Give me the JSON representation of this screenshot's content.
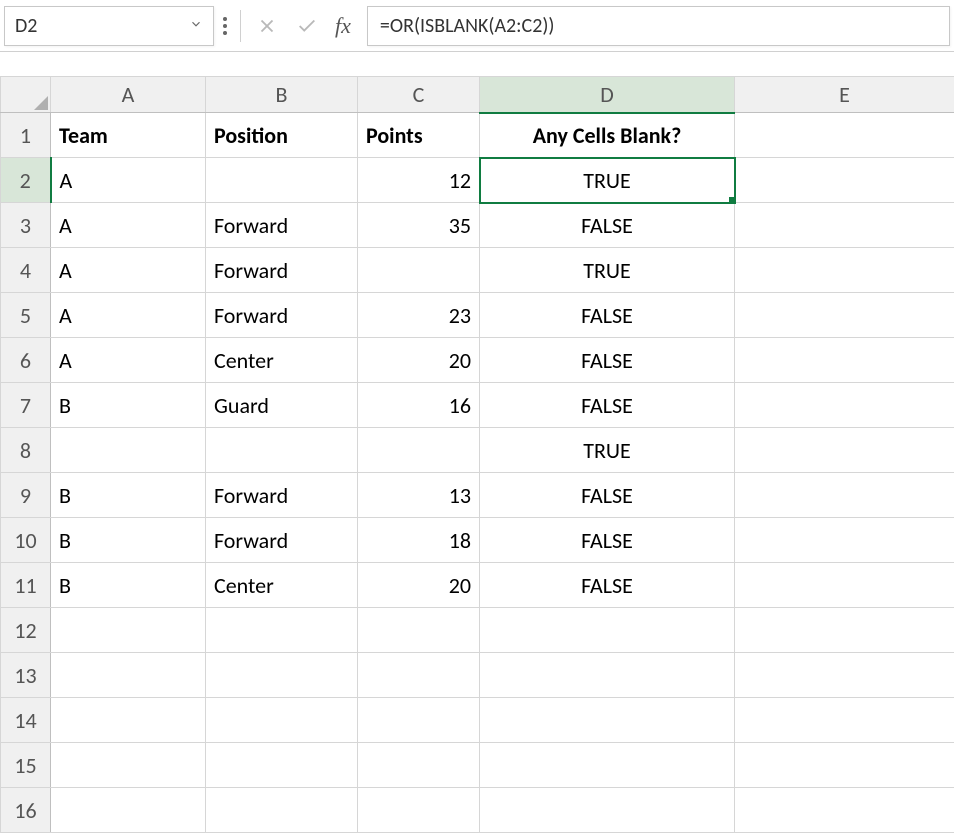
{
  "nameBox": "D2",
  "formula": "=OR(ISBLANK(A2:C2))",
  "fxLabel": "fx",
  "colHeaders": [
    "A",
    "B",
    "C",
    "D",
    "E"
  ],
  "rowHeaders": [
    "1",
    "2",
    "3",
    "4",
    "5",
    "6",
    "7",
    "8",
    "9",
    "10",
    "11",
    "12",
    "13",
    "14",
    "15",
    "16"
  ],
  "headerRow": {
    "team": "Team",
    "position": "Position",
    "points": "Points",
    "anyBlank": "Any Cells Blank?"
  },
  "rows": [
    {
      "team": "A",
      "position": "",
      "points": "12",
      "anyBlank": "TRUE"
    },
    {
      "team": "A",
      "position": "Forward",
      "points": "35",
      "anyBlank": "FALSE"
    },
    {
      "team": "A",
      "position": "Forward",
      "points": "",
      "anyBlank": "TRUE"
    },
    {
      "team": "A",
      "position": "Forward",
      "points": "23",
      "anyBlank": "FALSE"
    },
    {
      "team": "A",
      "position": "Center",
      "points": "20",
      "anyBlank": "FALSE"
    },
    {
      "team": "B",
      "position": "Guard",
      "points": "16",
      "anyBlank": "FALSE"
    },
    {
      "team": "",
      "position": "",
      "points": "",
      "anyBlank": "TRUE"
    },
    {
      "team": "B",
      "position": "Forward",
      "points": "13",
      "anyBlank": "FALSE"
    },
    {
      "team": "B",
      "position": "Forward",
      "points": "18",
      "anyBlank": "FALSE"
    },
    {
      "team": "B",
      "position": "Center",
      "points": "20",
      "anyBlank": "FALSE"
    }
  ],
  "chart_data": {
    "type": "table",
    "title": "",
    "columns": [
      "Team",
      "Position",
      "Points",
      "Any Cells Blank?"
    ],
    "data": [
      [
        "A",
        "",
        12,
        "TRUE"
      ],
      [
        "A",
        "Forward",
        35,
        "FALSE"
      ],
      [
        "A",
        "Forward",
        "",
        "TRUE"
      ],
      [
        "A",
        "Forward",
        23,
        "FALSE"
      ],
      [
        "A",
        "Center",
        20,
        "FALSE"
      ],
      [
        "B",
        "Guard",
        16,
        "FALSE"
      ],
      [
        "",
        "",
        "",
        "TRUE"
      ],
      [
        "B",
        "Forward",
        13,
        "FALSE"
      ],
      [
        "B",
        "Forward",
        18,
        "FALSE"
      ],
      [
        "B",
        "Center",
        20,
        "FALSE"
      ]
    ]
  }
}
